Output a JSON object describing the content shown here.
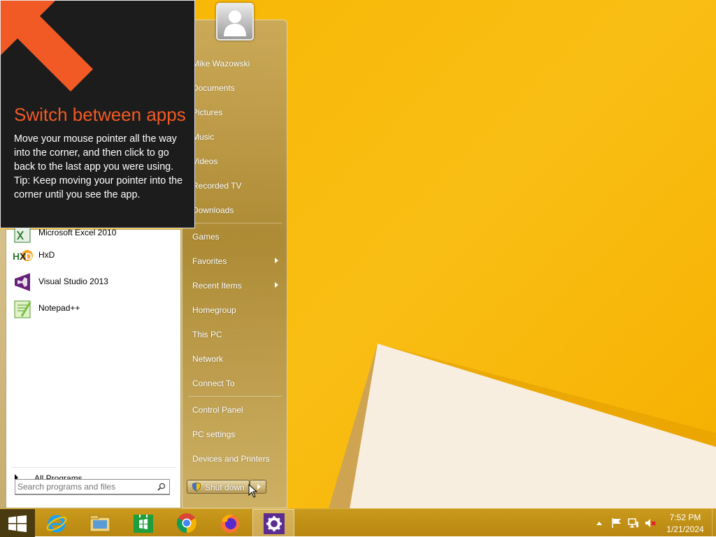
{
  "tip": {
    "title": "Switch between apps",
    "body_line1": "Move your mouse pointer all the way into the corner, and then click to go back to the last app you were using.",
    "body_line2": "Tip: Keep moving your pointer into the corner until you see the app."
  },
  "start_menu": {
    "partial_item_label": "Microsoft Excel 2010",
    "programs": [
      {
        "label": "HxD",
        "icon": "hxd-icon"
      },
      {
        "label": "Visual Studio 2013",
        "icon": "visual-studio-icon"
      },
      {
        "label": "Notepad++",
        "icon": "notepad-plus-plus-icon"
      }
    ],
    "all_programs_label": "All Programs",
    "search_placeholder": "Search programs and files",
    "right_items": {
      "user": "Mike Wazowski",
      "documents": "Documents",
      "pictures": "Pictures",
      "music": "Music",
      "videos": "Videos",
      "recorded_tv": "Recorded TV",
      "downloads": "Downloads",
      "games": "Games",
      "favorites": "Favorites",
      "recent_items": "Recent Items",
      "homegroup": "Homegroup",
      "this_pc": "This PC",
      "network": "Network",
      "connect_to": "Connect To",
      "control_panel": "Control Panel",
      "pc_settings": "PC settings",
      "devices_printers": "Devices and Printers"
    },
    "shutdown_label": "Shut down"
  },
  "taskbar": {
    "pinned": [
      "internet-explorer-icon",
      "file-explorer-icon",
      "store-icon",
      "chrome-icon",
      "firefox-icon",
      "settings-gear-icon"
    ],
    "active_item": "settings-gear-icon"
  },
  "clock": {
    "time": "7:52 PM",
    "date": "1/21/2024"
  },
  "colors": {
    "tip_title": "#f15a24",
    "wallpaper": "#f7b500",
    "taskbar": "#c0900f"
  }
}
